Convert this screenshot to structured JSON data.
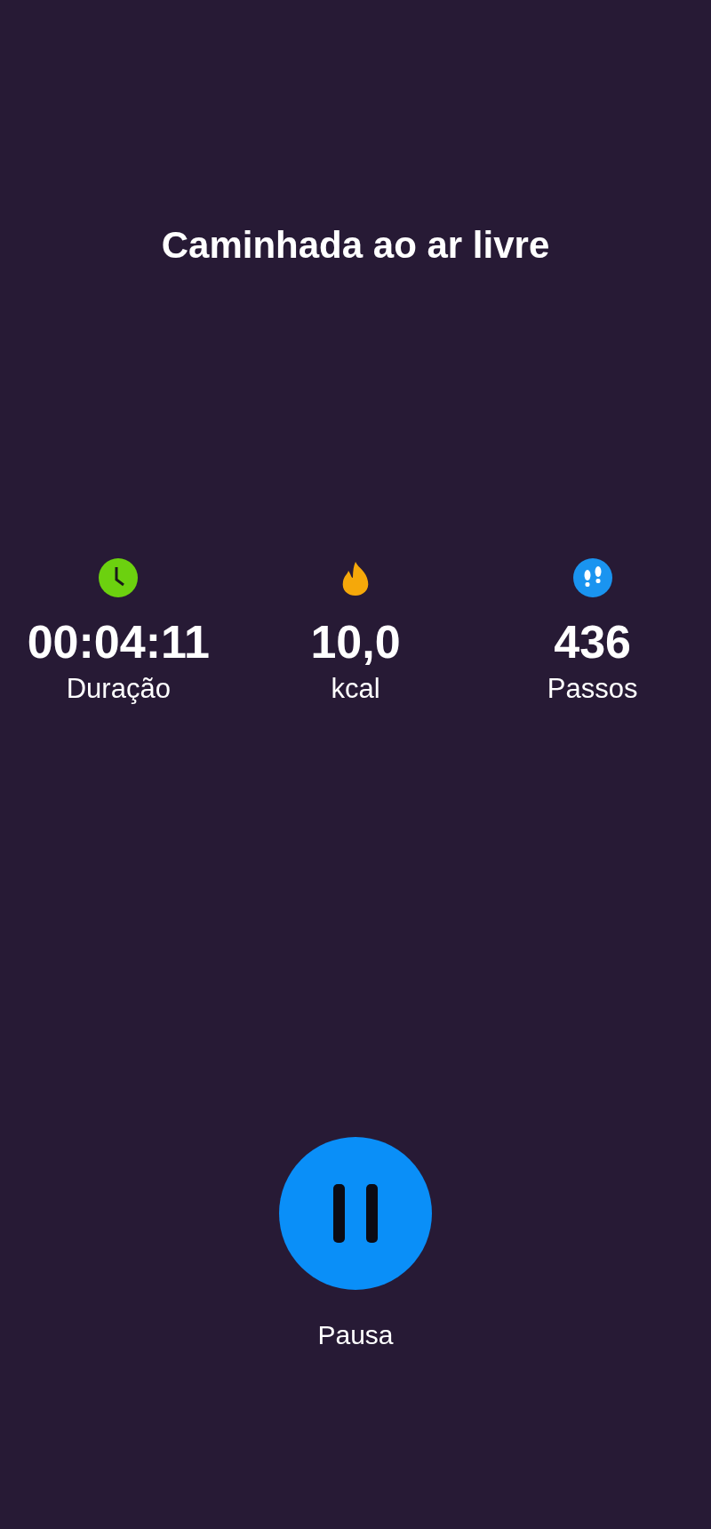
{
  "title": "Caminhada ao ar livre",
  "metrics": [
    {
      "kind": "clock",
      "color": "#6cd10f",
      "value": "00:04:11",
      "label": "Duração"
    },
    {
      "kind": "flame",
      "color": "#f5a80a",
      "value": "10,0",
      "label": "kcal"
    },
    {
      "kind": "footprints",
      "color": "#1a94f0",
      "value": "436",
      "label": "Passos"
    }
  ],
  "pause_button": {
    "label": "Pausa"
  }
}
